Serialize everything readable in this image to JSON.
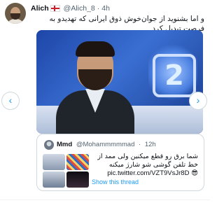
{
  "tweet": {
    "author_name": "Alich",
    "author_handle": "@Alich_8",
    "separator": "·",
    "time": "4h",
    "text": "و اما بشنوید از جوان‌خوش ذوق ایرانی  که تهدیدو به فرصت تبدیل کرد"
  },
  "media": {
    "logo_text": "2"
  },
  "carousel": {
    "prev_icon": "‹",
    "next_icon": "›"
  },
  "quoted": {
    "author_name": "Mmd",
    "author_handle": "@Mohammmmmad",
    "separator": "·",
    "time": "12h",
    "text": "شما برق رو قطع میکنین ولی ممد از خط تلفن گوشی شو شارژ میکنه",
    "link": "pic.twitter.com/VZT9VsJr8D",
    "emoji": "😎",
    "show_thread": "Show this thread"
  }
}
